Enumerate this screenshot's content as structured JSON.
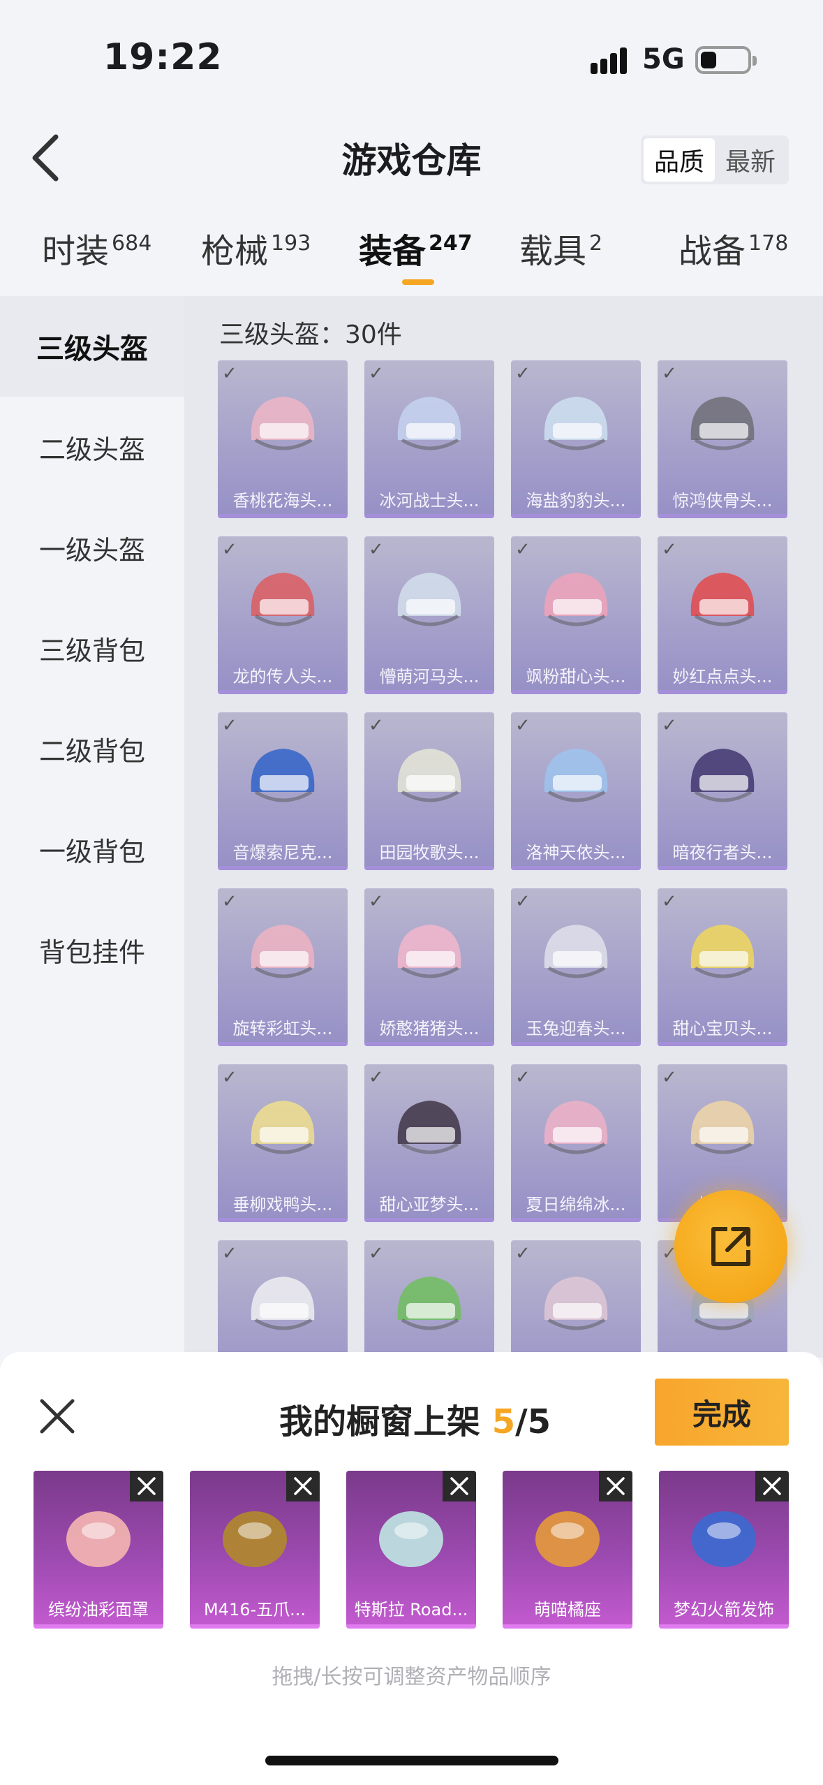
{
  "status": {
    "time": "19:22",
    "network": "5G"
  },
  "header": {
    "title": "游戏仓库",
    "sort_options": [
      "品质",
      "最新"
    ],
    "active_sort": "品质"
  },
  "tabs": [
    {
      "label": "时装",
      "count": "684"
    },
    {
      "label": "枪械",
      "count": "193"
    },
    {
      "label": "装备",
      "count": "247"
    },
    {
      "label": "载具",
      "count": "2"
    },
    {
      "label": "战备",
      "count": "178"
    }
  ],
  "active_tab": "装备",
  "sidebar": {
    "items": [
      "三级头盔",
      "二级头盔",
      "一级头盔",
      "三级背包",
      "二级背包",
      "一级背包",
      "背包挂件"
    ],
    "active": "三级头盔"
  },
  "panel": {
    "heading": "三级头盔：30件",
    "items": [
      {
        "name": "香桃花海头...",
        "color": "#f3b6c4"
      },
      {
        "name": "冰河战士头...",
        "color": "#c7d6f2"
      },
      {
        "name": "海盐豹豹头...",
        "color": "#cfe4f2"
      },
      {
        "name": "惊鸿侠骨头...",
        "color": "#6a6a70"
      },
      {
        "name": "龙的传人头...",
        "color": "#e0585a"
      },
      {
        "name": "懵萌河马头...",
        "color": "#d6e2ee"
      },
      {
        "name": "飒粉甜心头...",
        "color": "#f4a2b8"
      },
      {
        "name": "妙红点点头...",
        "color": "#e64444"
      },
      {
        "name": "音爆索尼克...",
        "color": "#2a5fc8"
      },
      {
        "name": "田园牧歌头...",
        "color": "#e8ead8"
      },
      {
        "name": "洛神天依头...",
        "color": "#9cc6f0"
      },
      {
        "name": "暗夜行者头...",
        "color": "#3b2f6a"
      },
      {
        "name": "旋转彩虹头...",
        "color": "#f2b4c2"
      },
      {
        "name": "娇憨猪猪头...",
        "color": "#f6b8cc"
      },
      {
        "name": "玉兔迎春头...",
        "color": "#e2e4ec"
      },
      {
        "name": "甜心宝贝头...",
        "color": "#f4da54"
      },
      {
        "name": "垂柳戏鸭头...",
        "color": "#f4e28a"
      },
      {
        "name": "甜心亚梦头...",
        "color": "#3a2e3e"
      },
      {
        "name": "夏日绵绵冰...",
        "color": "#f3b2c6"
      },
      {
        "name": "橘子...",
        "color": "#f4d8a4"
      },
      {
        "name": "",
        "color": "#f2f2f4"
      },
      {
        "name": "",
        "color": "#6cbf58"
      },
      {
        "name": "",
        "color": "#e2c9d6"
      },
      {
        "name": "",
        "color": "#9aa6bc"
      }
    ]
  },
  "sheet": {
    "title_prefix": "我的橱窗上架",
    "current": "5",
    "separator": "/",
    "total": "5",
    "done_label": "完成",
    "hint": "拖拽/长按可调整资产物品顺序",
    "items": [
      {
        "name": "缤纷油彩面罩",
        "color": "#f4b6b0"
      },
      {
        "name": "M416-五爪...",
        "color": "#b08a2a"
      },
      {
        "name": "特斯拉 Road...",
        "color": "#bfe6e2"
      },
      {
        "name": "萌喵橘座",
        "color": "#e49a3a"
      },
      {
        "name": "梦幻火箭发饰",
        "color": "#3a6ad0"
      }
    ]
  }
}
